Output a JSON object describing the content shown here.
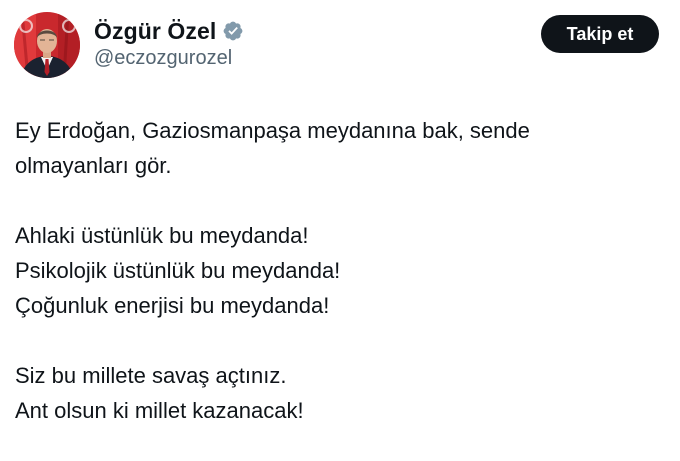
{
  "author": {
    "display_name": "Özgür Özel",
    "handle": "@eczozgurozel",
    "verified_icon": "verified-badge-icon",
    "verified_color": "#829aab"
  },
  "follow_button": {
    "label": "Takip et"
  },
  "tweet": {
    "lines": [
      "Ey Erdoğan, Gaziosmanpaşa meydanına bak, sende",
      "olmayanları gör.",
      "",
      "Ahlaki üstünlük bu meydanda!",
      "Psikolojik üstünlük bu meydanda!",
      "Çoğunluk enerjisi bu meydanda!",
      "",
      "Siz bu millete savaş açtınız.",
      "Ant olsun ki millet kazanacak!"
    ]
  },
  "colors": {
    "text_primary": "#0f1419",
    "text_secondary": "#536471",
    "button_bg": "#0f1419",
    "button_text": "#ffffff",
    "avatar_flag_red": "#d42a2e"
  }
}
